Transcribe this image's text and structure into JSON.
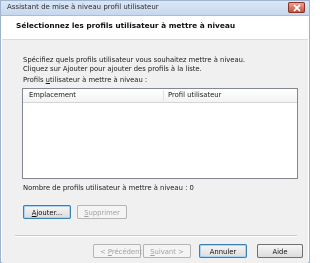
{
  "window": {
    "title": "Assistant de mise à niveau profil utilisateur"
  },
  "header": {
    "heading": "Sélectionnez les profils utilisateur à mettre à niveau"
  },
  "instructions": {
    "line1": "Spécifiez quels profils utilisateur vous souhaitez mettre à niveau.",
    "line2": "Cliquez sur Ajouter pour ajouter des profils à la liste."
  },
  "profiles_list": {
    "label_pre": "Profils ",
    "label_accel": "u",
    "label_post": "tilisateur à mettre à niveau :",
    "columns": [
      "Emplacement",
      "Profil utilisateur"
    ],
    "rows": []
  },
  "count": {
    "label": "Nombre de profils utilisateur à mettre à niveau :",
    "value": "0"
  },
  "buttons": {
    "add_accel": "A",
    "add_rest": "jouter...",
    "remove_accel": "S",
    "remove_rest": "upprimer",
    "prev_pre": "< ",
    "prev_accel": "P",
    "prev_rest": "récédent",
    "next_accel": "S",
    "next_rest": "uivant >",
    "cancel": "Annuler",
    "help": "Aide"
  }
}
